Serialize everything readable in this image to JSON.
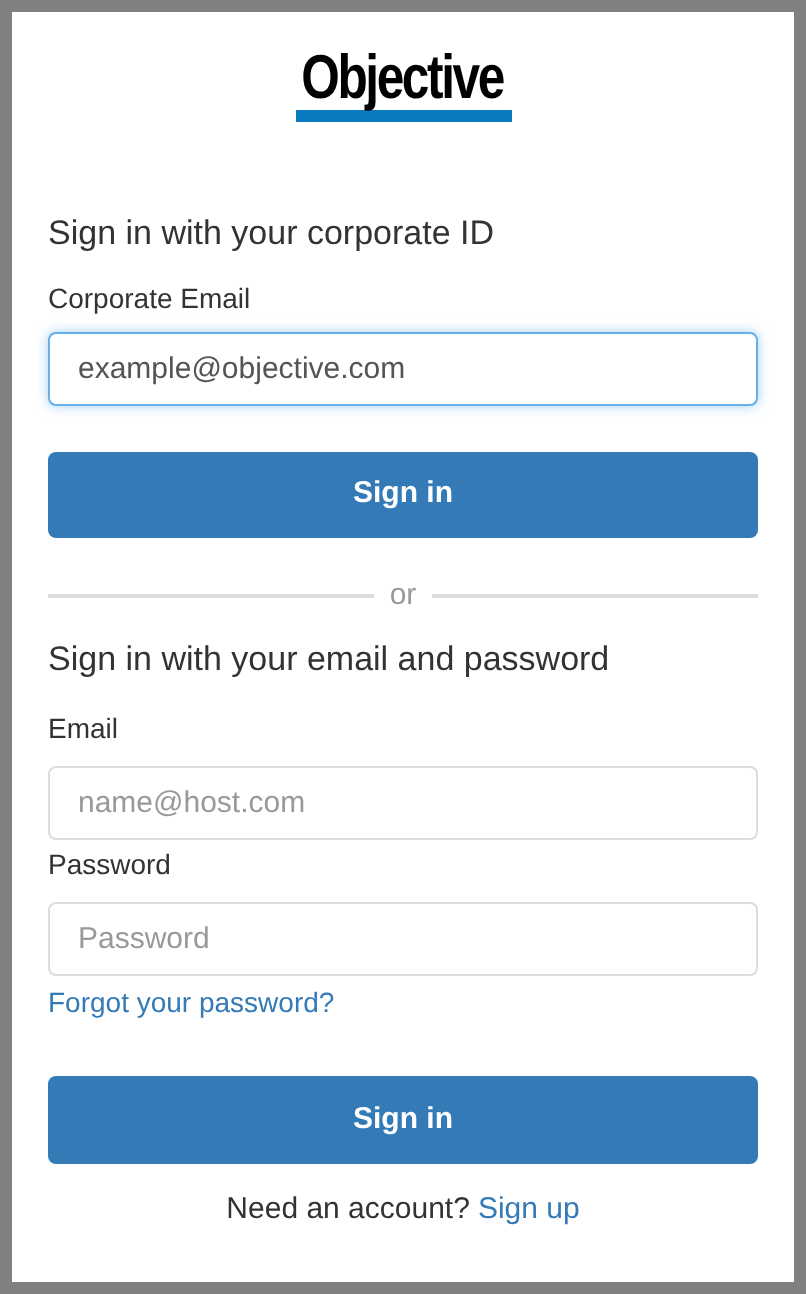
{
  "logo": {
    "text": "Objective"
  },
  "corporate": {
    "heading": "Sign in with your corporate ID",
    "label": "Corporate Email",
    "field": {
      "value": "example@objective.com",
      "focused": true
    },
    "button": "Sign in"
  },
  "divider": "or",
  "credentials": {
    "heading": "Sign in with your email and password",
    "fields": [
      {
        "label": "Email",
        "placeholder": "name@host.com",
        "focused": false
      },
      {
        "label": "Password",
        "placeholder": "Password",
        "focused": false
      }
    ],
    "forgot_link": "Forgot your password?",
    "button": "Sign in"
  },
  "footer": {
    "text": "Need an account?",
    "link": "Sign up"
  }
}
